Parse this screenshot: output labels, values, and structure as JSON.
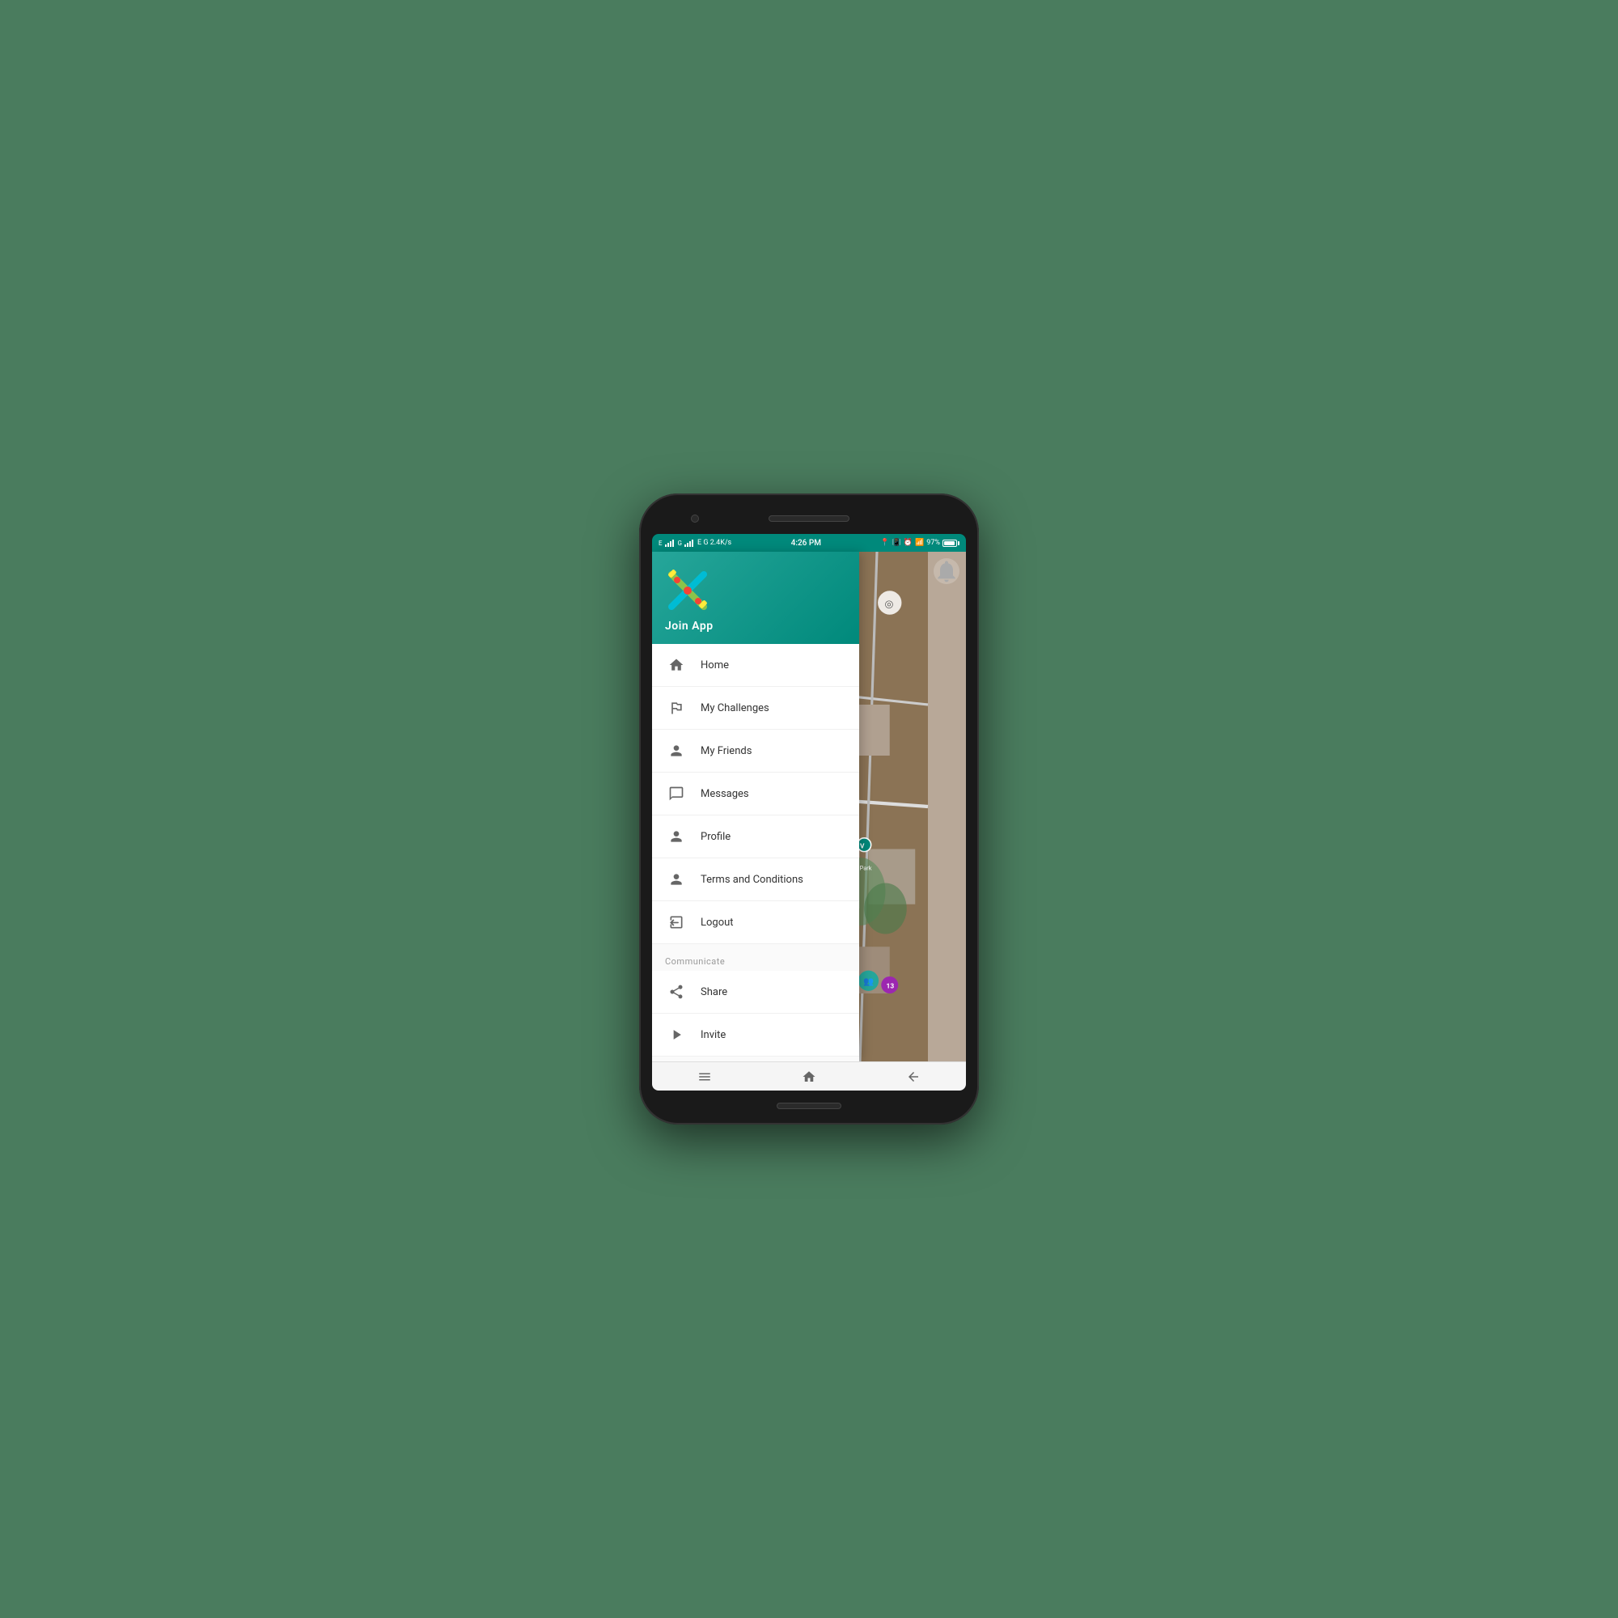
{
  "statusBar": {
    "left": "E  G 2.4K/s",
    "time": "4:26 PM",
    "battery": "97%"
  },
  "drawer": {
    "appName": "Join App",
    "menuItems": [
      {
        "id": "home",
        "label": "Home",
        "icon": "home"
      },
      {
        "id": "my-challenges",
        "label": "My Challenges",
        "icon": "challenges"
      },
      {
        "id": "my-friends",
        "label": "My Friends",
        "icon": "friends"
      },
      {
        "id": "messages",
        "label": "Messages",
        "icon": "messages"
      },
      {
        "id": "profile",
        "label": "Profile",
        "icon": "profile"
      },
      {
        "id": "terms",
        "label": "Terms and Conditions",
        "icon": "terms"
      },
      {
        "id": "logout",
        "label": "Logout",
        "icon": "logout"
      }
    ],
    "communicateSection": {
      "label": "Communicate",
      "items": [
        {
          "id": "share",
          "label": "Share",
          "icon": "share"
        },
        {
          "id": "invite",
          "label": "Invite",
          "icon": "invite"
        }
      ]
    }
  },
  "bottomNav": {
    "menu": "☰",
    "home": "⌂",
    "back": "⬅"
  }
}
